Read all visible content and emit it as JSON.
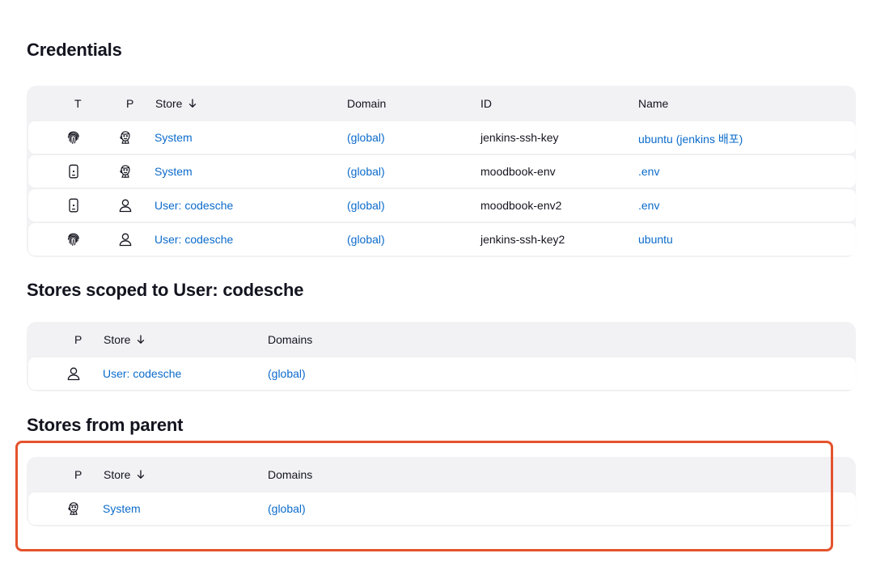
{
  "credentials": {
    "title": "Credentials",
    "headers": {
      "type": "T",
      "provider": "P",
      "store": "Store",
      "domain": "Domain",
      "id": "ID",
      "name": "Name"
    },
    "rows": [
      {
        "type_icon": "fingerprint-icon",
        "provider_icon": "jenkins-butler-icon",
        "store": "System",
        "domain": "(global)",
        "id": "jenkins-ssh-key",
        "name": "ubuntu (jenkins 배포)"
      },
      {
        "type_icon": "mobile-device-icon",
        "provider_icon": "jenkins-butler-icon",
        "store": "System",
        "domain": "(global)",
        "id": "moodbook-env",
        "name": ".env"
      },
      {
        "type_icon": "mobile-device-icon",
        "provider_icon": "user-icon",
        "store": "User: codesche",
        "domain": "(global)",
        "id": "moodbook-env2",
        "name": ".env"
      },
      {
        "type_icon": "fingerprint-icon",
        "provider_icon": "user-icon",
        "store": "User: codesche",
        "domain": "(global)",
        "id": "jenkins-ssh-key2",
        "name": "ubuntu"
      }
    ]
  },
  "user_stores": {
    "title": "Stores scoped to User: codesche",
    "headers": {
      "provider": "P",
      "store": "Store",
      "domains": "Domains"
    },
    "rows": [
      {
        "provider_icon": "user-icon",
        "store": "User: codesche",
        "domains": "(global)"
      }
    ]
  },
  "parent_stores": {
    "title": "Stores from parent",
    "headers": {
      "provider": "P",
      "store": "Store",
      "domains": "Domains"
    },
    "rows": [
      {
        "provider_icon": "jenkins-butler-icon",
        "store": "System",
        "domains": "(global)"
      }
    ]
  },
  "colors": {
    "link": "#0b6bcb",
    "panel": "#f2f2f5",
    "highlight": "#e4532c"
  }
}
